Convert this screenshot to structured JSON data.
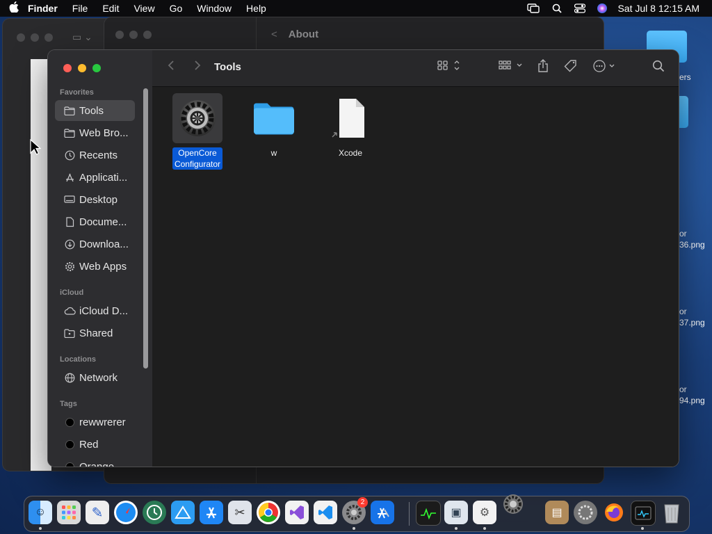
{
  "menubar": {
    "app": "Finder",
    "items": [
      "File",
      "Edit",
      "View",
      "Go",
      "Window",
      "Help"
    ],
    "clock": "Sat Jul 8  12:15 AM"
  },
  "desktop": {
    "labels": [
      "ers",
      "or",
      "36.png",
      "or",
      "37.png",
      "or",
      "94.png"
    ]
  },
  "background_window": {
    "title": "About"
  },
  "finder": {
    "title": "Tools",
    "sidebar": {
      "favorites_header": "Favorites",
      "favorites": [
        {
          "label": "Tools",
          "icon": "folder-icon"
        },
        {
          "label": "Web Bro...",
          "icon": "folder-icon"
        },
        {
          "label": "Recents",
          "icon": "clock-icon"
        },
        {
          "label": "Applicati...",
          "icon": "applications-icon"
        },
        {
          "label": "Desktop",
          "icon": "desktop-icon"
        },
        {
          "label": "Docume...",
          "icon": "document-icon"
        },
        {
          "label": "Downloa...",
          "icon": "download-icon"
        },
        {
          "label": "Web Apps",
          "icon": "gear-icon"
        }
      ],
      "icloud_header": "iCloud",
      "icloud": [
        {
          "label": "iCloud D...",
          "icon": "cloud-icon"
        },
        {
          "label": "Shared",
          "icon": "shared-folder-icon"
        }
      ],
      "locations_header": "Locations",
      "locations": [
        {
          "label": "Network",
          "icon": "globe-icon"
        }
      ],
      "tags_header": "Tags",
      "tags": [
        {
          "label": "rewwrerer",
          "color": "#000000"
        },
        {
          "label": "Red",
          "color": "#000000"
        },
        {
          "label": "Orange",
          "color": "#000000"
        }
      ]
    },
    "files": [
      {
        "name_line1": "OpenCore",
        "name_line2": "Configurator",
        "icon": "gear-app-icon",
        "selected": true
      },
      {
        "name_line1": "w",
        "name_line2": "",
        "icon": "folder-icon",
        "selected": false
      },
      {
        "name_line1": "Xcode",
        "name_line2": "",
        "icon": "alias-document-icon",
        "selected": false
      }
    ]
  },
  "dock": {
    "apps": [
      "Finder",
      "Launchpad",
      "TextEdit",
      "Safari",
      "Time Machine",
      "Preview",
      "App Store",
      "Utility",
      "Chrome",
      "Visual Studio",
      "VS Code",
      "System Preferences",
      "Xcode",
      "Activity Monitor",
      "Image Capture",
      "Automator",
      "Settings",
      "Archive",
      "Disk Utility",
      "Firefox",
      "Monitor",
      "Trash"
    ],
    "badge": "2"
  },
  "colors": {
    "selection": "#0a5ad6",
    "folder": "#4fb8fa",
    "sidebar_bg": "#2d2d30",
    "content_bg": "#1e1e1e"
  }
}
